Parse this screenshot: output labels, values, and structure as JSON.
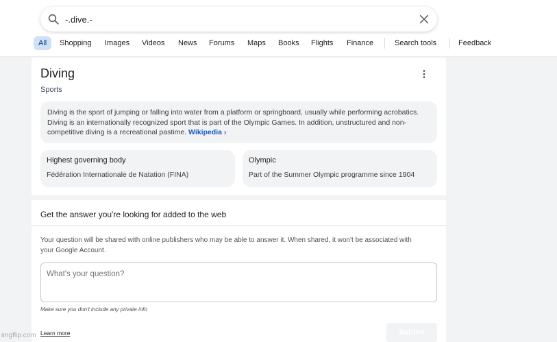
{
  "search": {
    "query": "-.dive.-"
  },
  "tabs": [
    {
      "label": "All",
      "active": true
    },
    {
      "label": "Shopping"
    },
    {
      "label": "Images"
    },
    {
      "label": "Videos"
    },
    {
      "label": "News"
    },
    {
      "label": "Forums"
    },
    {
      "label": "Maps"
    },
    {
      "label": "Books"
    },
    {
      "label": "Flights"
    },
    {
      "label": "Finance"
    }
  ],
  "toolbar": {
    "search_tools": "Search tools",
    "feedback": "Feedback"
  },
  "knowledge_panel": {
    "title": "Diving",
    "subtitle": "Sports",
    "description": "Diving is the sport of jumping or falling into water from a platform or springboard, usually while performing acrobatics. Diving is an internationally recognized sport that is part of the Olympic Games. In addition, unstructured and non-competitive diving is a recreational pastime.",
    "source_link": "Wikipedia ›",
    "facts": [
      {
        "label": "Highest governing body",
        "value": "Fédération Internationale de Natation (FINA)"
      },
      {
        "label": "Olympic",
        "value": "Part of the Summer Olympic programme since 1904"
      }
    ]
  },
  "ask_section": {
    "title": "Get the answer you're looking for added to the web",
    "note": "Your question will be shared with online publishers who may be able to answer it. When shared, it won't be associated with your Google Account.",
    "question_placeholder": "What's your question?",
    "privacy_note": "Make sure you don't include any private info",
    "learn_more": "Learn more",
    "submit": "Submit"
  },
  "watermark": "imgflip.com",
  "colors": {
    "accent": "#1a57c7",
    "active_tab_bg": "#cfe0f7",
    "page_bg": "#f1f3f4"
  }
}
